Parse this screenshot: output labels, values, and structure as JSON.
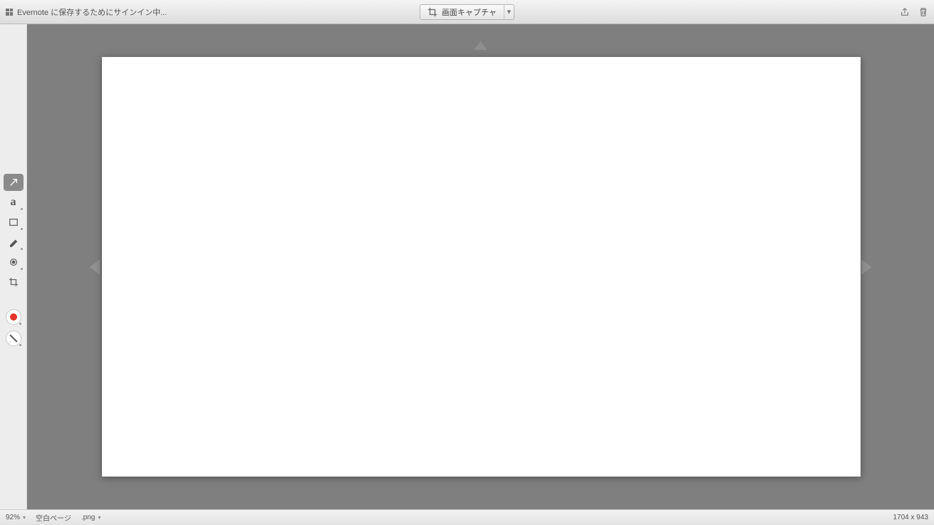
{
  "topbar": {
    "title": "Evernote に保存するためにサインイン中...",
    "capture_label": "画面キャプチャ"
  },
  "sidebar": {
    "tools": [
      {
        "id": "arrow",
        "label": "arrow-tool"
      },
      {
        "id": "text",
        "label": "text-tool"
      },
      {
        "id": "rect",
        "label": "rectangle-tool"
      },
      {
        "id": "pen",
        "label": "pen-tool"
      },
      {
        "id": "blur",
        "label": "pixelate-tool"
      },
      {
        "id": "crop",
        "label": "crop-tool"
      }
    ],
    "swatch_color": "#e53528"
  },
  "statusbar": {
    "zoom": "92%",
    "page_label": "空白ページ",
    "format": ".png",
    "dimensions": "1704 x 943"
  }
}
